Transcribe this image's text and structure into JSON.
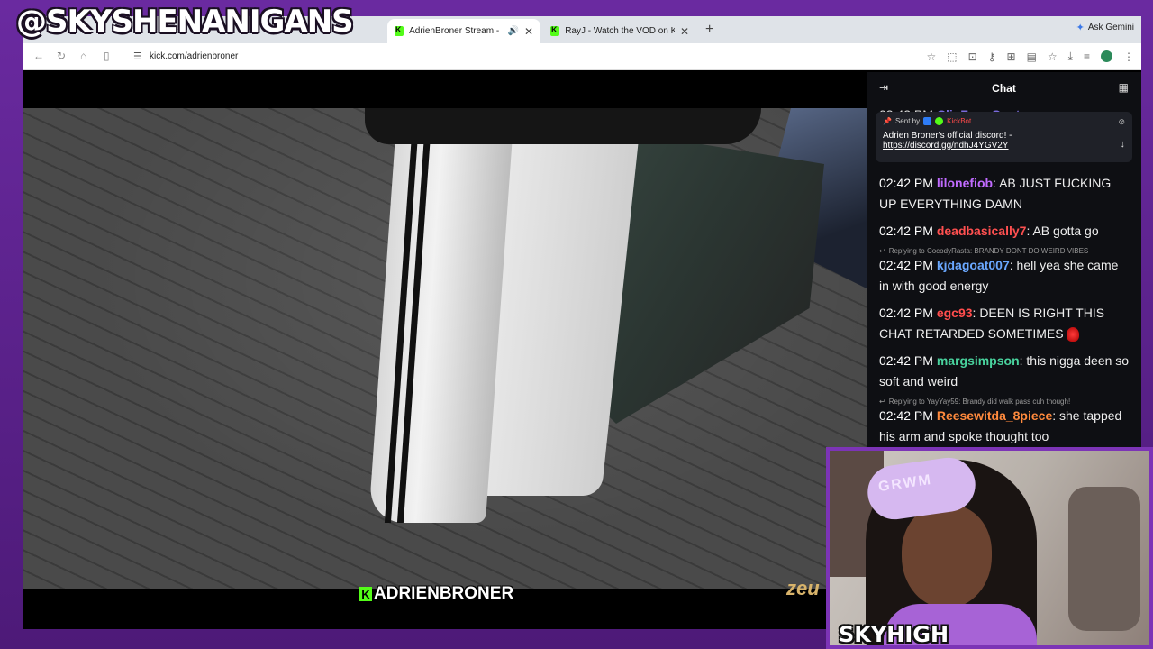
{
  "overlay": {
    "channel_handle": "@SKYSHENANIGANS",
    "cam_label": "SKYHIGH",
    "cam_bow_text": "GRWM"
  },
  "browser": {
    "tabs": [
      {
        "title": "AdrienBroner Stream - W",
        "active": true,
        "audio": true
      },
      {
        "title": "RayJ - Watch the VOD on Kic",
        "active": false,
        "audio": false
      }
    ],
    "new_tab": "+",
    "gemini_label": "Ask Gemini",
    "url": "kick.com/adrienbroner"
  },
  "video": {
    "streamer_tag": "ADRIENBRONER",
    "sponsor_logo": "zeu"
  },
  "chat": {
    "title": "Chat",
    "pinned": {
      "sent_by": "Sent by",
      "author": "KickBot",
      "message": "Adrien Broner's official discord! -",
      "link": "https://discord.gg/ndhJ4YGV2Y"
    },
    "messages": [
      {
        "time": "02:42 PM",
        "user": "ClipFarmGoatz",
        "color": "#8c7bff",
        "text": "",
        "partial": true
      },
      {
        "time": "02:42 PM",
        "user": "lilonefiob",
        "color": "#c06bff",
        "text": "AB JUST FUCKING UP EVERYTHING DAMN",
        "partial": true
      },
      {
        "time": "02:42 PM",
        "user": "deadbasically7",
        "color": "#ff5050",
        "text": "AB gotta go"
      },
      {
        "reply": "Replying to CocodyRasta: BRANDY DONT DO WEIRD VIBES"
      },
      {
        "time": "02:42 PM",
        "user": "kjdagoat007",
        "color": "#6aa8ff",
        "text": "hell yea she came in with good energy"
      },
      {
        "time": "02:42 PM",
        "user": "egc93",
        "color": "#ff4d4d",
        "text": "DEEN IS RIGHT THIS CHAT RETARDED SOMETIMES"
      },
      {
        "time": "02:42 PM",
        "user": "margsimpson",
        "color": "#49d39e",
        "text": "this nigga deen so soft and weird"
      },
      {
        "reply": "Replying to YayYay59: Brandy did walk pass cuh though!"
      },
      {
        "time": "02:42 PM",
        "user": "Reesewitda_8piece",
        "color": "#ff8a3d",
        "text": "she tapped his arm and spoke thought too"
      }
    ]
  },
  "colors": {
    "frame": "#5a1f86",
    "kick_green": "#53fc18",
    "chat_bg": "#0e0f13"
  }
}
